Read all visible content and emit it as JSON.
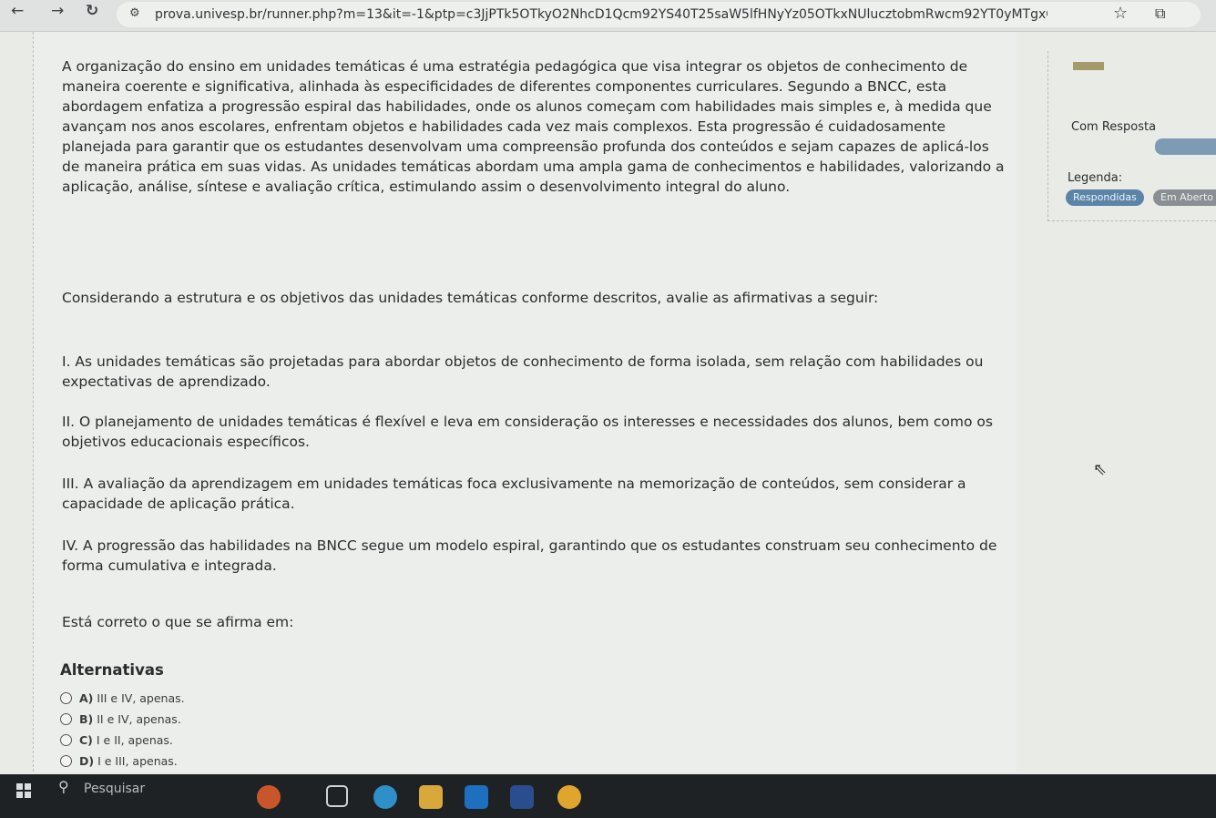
{
  "browser": {
    "url": "prova.univesp.br/runner.php?m=13&it=-1&ptp=c3JjPTk5OTkyO2NhcD1Qcm92YS40T25saW5lfHNyYz05OTkxNUlucztobmRwcm92YT0yMTgxO2huZGFsd..."
  },
  "question": {
    "intro": "A organização do ensino em unidades temáticas é uma estratégia pedagógica que visa integrar os objetos de conhecimento de maneira coerente e significativa, alinhada às especificidades de diferentes componentes curriculares. Segundo a BNCC, esta abordagem enfatiza a progressão espiral das habilidades, onde os alunos começam com habilidades mais simples e, à medida que avançam nos anos escolares, enfrentam objetos e habilidades cada vez mais complexos. Esta progressão é cuidadosamente planejada para garantir que os estudantes desenvolvam uma compreensão profunda dos conteúdos e sejam capazes de aplicá-los de maneira prática em suas vidas. As unidades temáticas abordam uma ampla gama de conhecimentos e habilidades, valorizando a aplicação, análise, síntese e avaliação crítica, estimulando assim o desenvolvimento integral do aluno.",
    "instruction": "Considerando a estrutura e os objetivos das unidades temáticas conforme descritos, avalie as afirmativas a seguir:",
    "statements": [
      "I. As unidades temáticas são projetadas para abordar objetos de conhecimento de forma isolada, sem relação com habilidades ou expectativas de aprendizado.",
      "II. O planejamento de unidades temáticas é flexível e leva em consideração os interesses e necessidades dos alunos, bem como os objetivos educacionais específicos.",
      "III. A avaliação da aprendizagem em unidades temáticas foca exclusivamente na memorização de conteúdos, sem considerar a capacidade de aplicação prática.",
      "IV. A progressão das habilidades na BNCC segue um modelo espiral, garantindo que os estudantes construam seu conhecimento de forma cumulativa e integrada."
    ],
    "prompt": "Está correto o que se afirma em:"
  },
  "alternatives": {
    "heading": "Alternativas",
    "options": [
      {
        "letter": "A)",
        "text": "III e IV, apenas."
      },
      {
        "letter": "B)",
        "text": "II e IV, apenas."
      },
      {
        "letter": "C)",
        "text": "I e II, apenas."
      },
      {
        "letter": "D)",
        "text": "I e III, apenas."
      }
    ]
  },
  "side_panel": {
    "status_label": "Com Resposta",
    "legend_label": "Legenda:",
    "badge_answered": "Respondidas",
    "badge_open": "Em Aberto",
    "colors": {
      "answered": "#5c84a8",
      "open": "#8a8f93",
      "progress": "#7e9bb5"
    }
  },
  "taskbar": {
    "search_placeholder": "Pesquisar"
  }
}
